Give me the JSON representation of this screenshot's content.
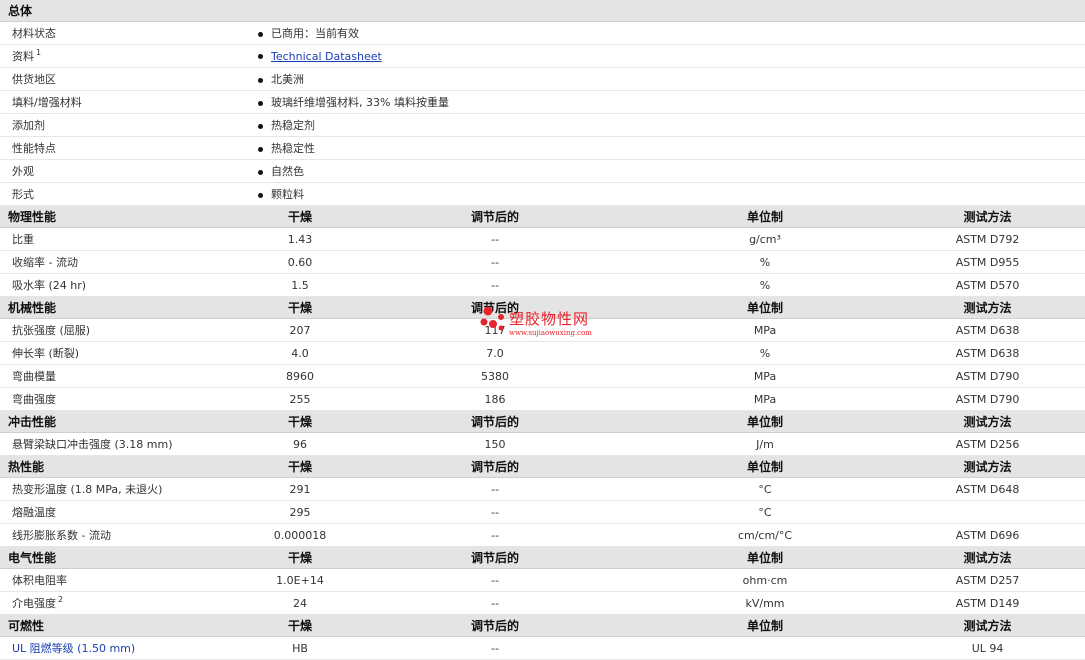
{
  "general": {
    "title": "总体",
    "rows": [
      {
        "label": "材料状态",
        "value": "已商用：当前有效"
      },
      {
        "label": "资料",
        "sup": "1",
        "link": "Technical Datasheet"
      },
      {
        "label": "供货地区",
        "value": "北美洲"
      },
      {
        "label": "填料/增强材料",
        "value": "玻璃纤维增强材料, 33% 填料按重量"
      },
      {
        "label": "添加剂",
        "value": "热稳定剂"
      },
      {
        "label": "性能特点",
        "value": "热稳定性"
      },
      {
        "label": "外观",
        "value": "自然色"
      },
      {
        "label": "形式",
        "value": "颗粒料"
      }
    ]
  },
  "columns": {
    "dry": "干燥",
    "conditioned": "调节后的",
    "unit": "单位制",
    "method": "测试方法"
  },
  "sections": [
    {
      "title": "物理性能",
      "rows": [
        {
          "name": "比重",
          "dry": "1.43",
          "cond": "--",
          "unit": "g/cm³",
          "method": "ASTM D792"
        },
        {
          "name": "收缩率 - 流动",
          "dry": "0.60",
          "cond": "--",
          "unit": "%",
          "method": "ASTM D955"
        },
        {
          "name": "吸水率 (24 hr)",
          "dry": "1.5",
          "cond": "--",
          "unit": "%",
          "method": "ASTM D570"
        }
      ]
    },
    {
      "title": "机械性能",
      "rows": [
        {
          "name": "抗张强度 (屈服)",
          "dry": "207",
          "cond": "117",
          "unit": "MPa",
          "method": "ASTM D638"
        },
        {
          "name": "伸长率 (断裂)",
          "dry": "4.0",
          "cond": "7.0",
          "unit": "%",
          "method": "ASTM D638"
        },
        {
          "name": "弯曲模量",
          "dry": "8960",
          "cond": "5380",
          "unit": "MPa",
          "method": "ASTM D790"
        },
        {
          "name": "弯曲强度",
          "dry": "255",
          "cond": "186",
          "unit": "MPa",
          "method": "ASTM D790"
        }
      ]
    },
    {
      "title": "冲击性能",
      "rows": [
        {
          "name": "悬臂梁缺口冲击强度 (3.18 mm)",
          "dry": "96",
          "cond": "150",
          "unit": "J/m",
          "method": "ASTM D256"
        }
      ]
    },
    {
      "title": "热性能",
      "rows": [
        {
          "name": "热变形温度 (1.8 MPa, 未退火)",
          "dry": "291",
          "cond": "--",
          "unit": "°C",
          "method": "ASTM D648"
        },
        {
          "name": "熔融温度",
          "dry": "295",
          "cond": "--",
          "unit": "°C",
          "method": ""
        },
        {
          "name": "线形膨胀系数 - 流动",
          "dry": "0.000018",
          "cond": "--",
          "unit": "cm/cm/°C",
          "method": "ASTM D696"
        }
      ]
    },
    {
      "title": "电气性能",
      "rows": [
        {
          "name": "体积电阻率",
          "dry": "1.0E+14",
          "cond": "--",
          "unit": "ohm·cm",
          "method": "ASTM D257"
        },
        {
          "name": "介电强度",
          "sup": "2",
          "dry": "24",
          "cond": "--",
          "unit": "kV/mm",
          "method": "ASTM D149"
        }
      ]
    },
    {
      "title": "可燃性",
      "rows": [
        {
          "name": "UL 阻燃等级 (1.50 mm)",
          "dry": "HB",
          "cond": "--",
          "unit": "",
          "method": "UL 94",
          "link": true
        }
      ]
    }
  ],
  "watermark": {
    "title": "塑胶物性网",
    "url": "www.sujiaowuxing.com"
  },
  "colors": {
    "header_bg": "#e4e4e4",
    "link": "#1a3fb5",
    "watermark": "#e8232c"
  }
}
